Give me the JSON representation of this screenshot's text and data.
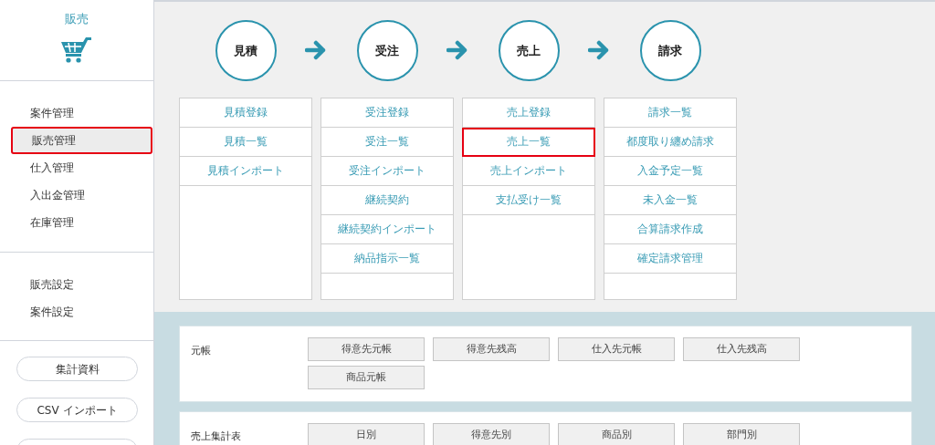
{
  "sidebar": {
    "title": "販売",
    "groups": [
      [
        {
          "label": "案件管理",
          "selected": false,
          "highlighted": false
        },
        {
          "label": "販売管理",
          "selected": true,
          "highlighted": true
        },
        {
          "label": "仕入管理",
          "selected": false,
          "highlighted": false
        },
        {
          "label": "入出金管理",
          "selected": false,
          "highlighted": false
        },
        {
          "label": "在庫管理",
          "selected": false,
          "highlighted": false
        }
      ],
      [
        {
          "label": "販売設定",
          "selected": false,
          "highlighted": false
        },
        {
          "label": "案件設定",
          "selected": false,
          "highlighted": false
        }
      ]
    ],
    "buttons": [
      "集計資料",
      "CSV インポート"
    ]
  },
  "flow": [
    {
      "step": "見積",
      "items": [
        {
          "label": "見積登録",
          "highlighted": false
        },
        {
          "label": "見積一覧",
          "highlighted": false
        },
        {
          "label": "見積インポート",
          "highlighted": false
        }
      ]
    },
    {
      "step": "受注",
      "items": [
        {
          "label": "受注登録",
          "highlighted": false
        },
        {
          "label": "受注一覧",
          "highlighted": false
        },
        {
          "label": "受注インポート",
          "highlighted": false
        },
        {
          "label": "継続契約",
          "highlighted": false
        },
        {
          "label": "継続契約インポート",
          "highlighted": false
        },
        {
          "label": "納品指示一覧",
          "highlighted": false
        }
      ]
    },
    {
      "step": "売上",
      "items": [
        {
          "label": "売上登録",
          "highlighted": false
        },
        {
          "label": "売上一覧",
          "highlighted": true
        },
        {
          "label": "売上インポート",
          "highlighted": false
        },
        {
          "label": "支払受け一覧",
          "highlighted": false
        }
      ]
    },
    {
      "step": "請求",
      "items": [
        {
          "label": "請求一覧",
          "highlighted": false
        },
        {
          "label": "都度取り纏め請求",
          "highlighted": false
        },
        {
          "label": "入金予定一覧",
          "highlighted": false
        },
        {
          "label": "未入金一覧",
          "highlighted": false
        },
        {
          "label": "合算請求作成",
          "highlighted": false
        },
        {
          "label": "確定請求管理",
          "highlighted": false
        }
      ]
    }
  ],
  "reports": [
    {
      "label": "元帳",
      "buttons": [
        "得意先元帳",
        "得意先残高",
        "仕入先元帳",
        "仕入先残高",
        "商品元帳"
      ]
    },
    {
      "label": "売上集計表",
      "buttons": [
        "日別",
        "得意先別",
        "商品別",
        "部門別"
      ]
    }
  ]
}
